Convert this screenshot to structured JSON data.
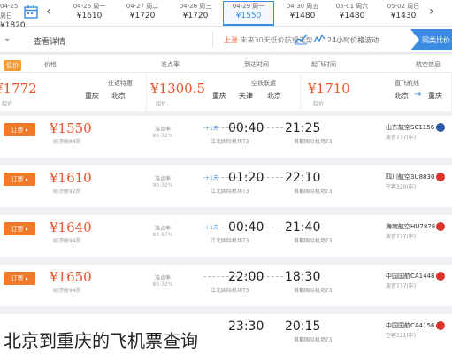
{
  "date_strip": {
    "prev_label": "‹",
    "next_label": "›",
    "calendar_icon": "calendar-icon",
    "dates": [
      {
        "day": "04-25 周日",
        "price": "¥1820"
      },
      {
        "day": "04-26 周一",
        "price": "¥1610"
      },
      {
        "day": "04-27 周二",
        "price": "¥1720"
      },
      {
        "day": "04-28 周三",
        "price": "¥1720"
      },
      {
        "day": "04-29 周一",
        "price": "¥1550"
      },
      {
        "day": "04-30 周五",
        "price": "¥1480"
      },
      {
        "day": "05-01 周六",
        "price": "¥1480"
      },
      {
        "day": "05-02 周日",
        "price": "¥1430"
      }
    ],
    "active_index": 4
  },
  "filter_bar": {
    "details_label": "查看详情",
    "trend_text": "未来30天低价航班走势",
    "trend_highlight": "上涨",
    "lowprice_text": "24小时价格波动",
    "compare_label": "同类比价"
  },
  "sort_header": {
    "cols": [
      "航空信息",
      "起飞时间",
      "到达时间",
      "准点率",
      "价格"
    ],
    "badge": "低价"
  },
  "summary": [
    {
      "title": "直飞航线",
      "from": "北京",
      "to": "重庆",
      "price": "¥1710",
      "sub": "起价"
    },
    {
      "title": "空铁联运",
      "from": "北京",
      "to": "重庆",
      "via": "天津",
      "price": "¥1300.5",
      "sub": "起价"
    },
    {
      "title": "往返特惠",
      "from": "北京",
      "to": "重庆",
      "price": "¥1772",
      "sub": "起价"
    }
  ],
  "flights": [
    {
      "airline": "山东航空SC1156",
      "aircraft": "波音737(中)",
      "dep": "21:25",
      "dep_ap": "首都国际机场T3",
      "arr": "00:40",
      "arr_ap": "江北国际机场T3",
      "stop": "+1天",
      "ontime": "准点率",
      "ontime_val": "80.32%",
      "price": "¥1550",
      "note": "经济舱88折",
      "book": "订票",
      "logo": "#2d5aa8"
    },
    {
      "airline": "四川航空3U8830",
      "aircraft": "空客320(中)",
      "dep": "22:10",
      "dep_ap": "首都国际机场T3",
      "arr": "01:20",
      "arr_ap": "江北国际机场T3",
      "stop": "+1天",
      "ontime": "准点率",
      "ontime_val": "90.32%",
      "price": "¥1610",
      "note": "经济舱92折",
      "book": "订票",
      "logo": "#d9342b"
    },
    {
      "airline": "海南航空HU7878",
      "aircraft": "波音737(中)",
      "dep": "21:40",
      "dep_ap": "首都国际机场T3",
      "arr": "00:40",
      "arr_ap": "江北国际机场T3",
      "stop": "+1天",
      "ontime": "准点率",
      "ontime_val": "84.87%",
      "price": "¥1640",
      "note": "经济舱94折",
      "book": "订票",
      "logo": "#d9342b"
    },
    {
      "airline": "中国国航CA1448",
      "aircraft": "波音737(中)",
      "dep": "18:30",
      "dep_ap": "首都国际机场T3",
      "arr": "22:00",
      "arr_ap": "江北国际机场T3",
      "stop": "",
      "ontime": "准点率",
      "ontime_val": "80.32%",
      "price": "¥1650",
      "note": "经济舱94折",
      "book": "订票",
      "logo": "#d9342b"
    },
    {
      "airline": "中国国航CA4156",
      "aircraft": "空客321(中)",
      "dep": "20:15",
      "dep_ap": "首都国际机场T3",
      "arr": "23:30",
      "arr_ap": "江北国际机场T3",
      "stop": "",
      "ontime": "准点率",
      "ontime_val": "",
      "price": "",
      "note": "",
      "book": "订票",
      "logo": "#d9342b"
    }
  ],
  "caption": "北京到重庆的飞机票查询",
  "colors": {
    "accent": "#3b8be0",
    "price": "#e5552b",
    "book": "#f07a2a"
  }
}
